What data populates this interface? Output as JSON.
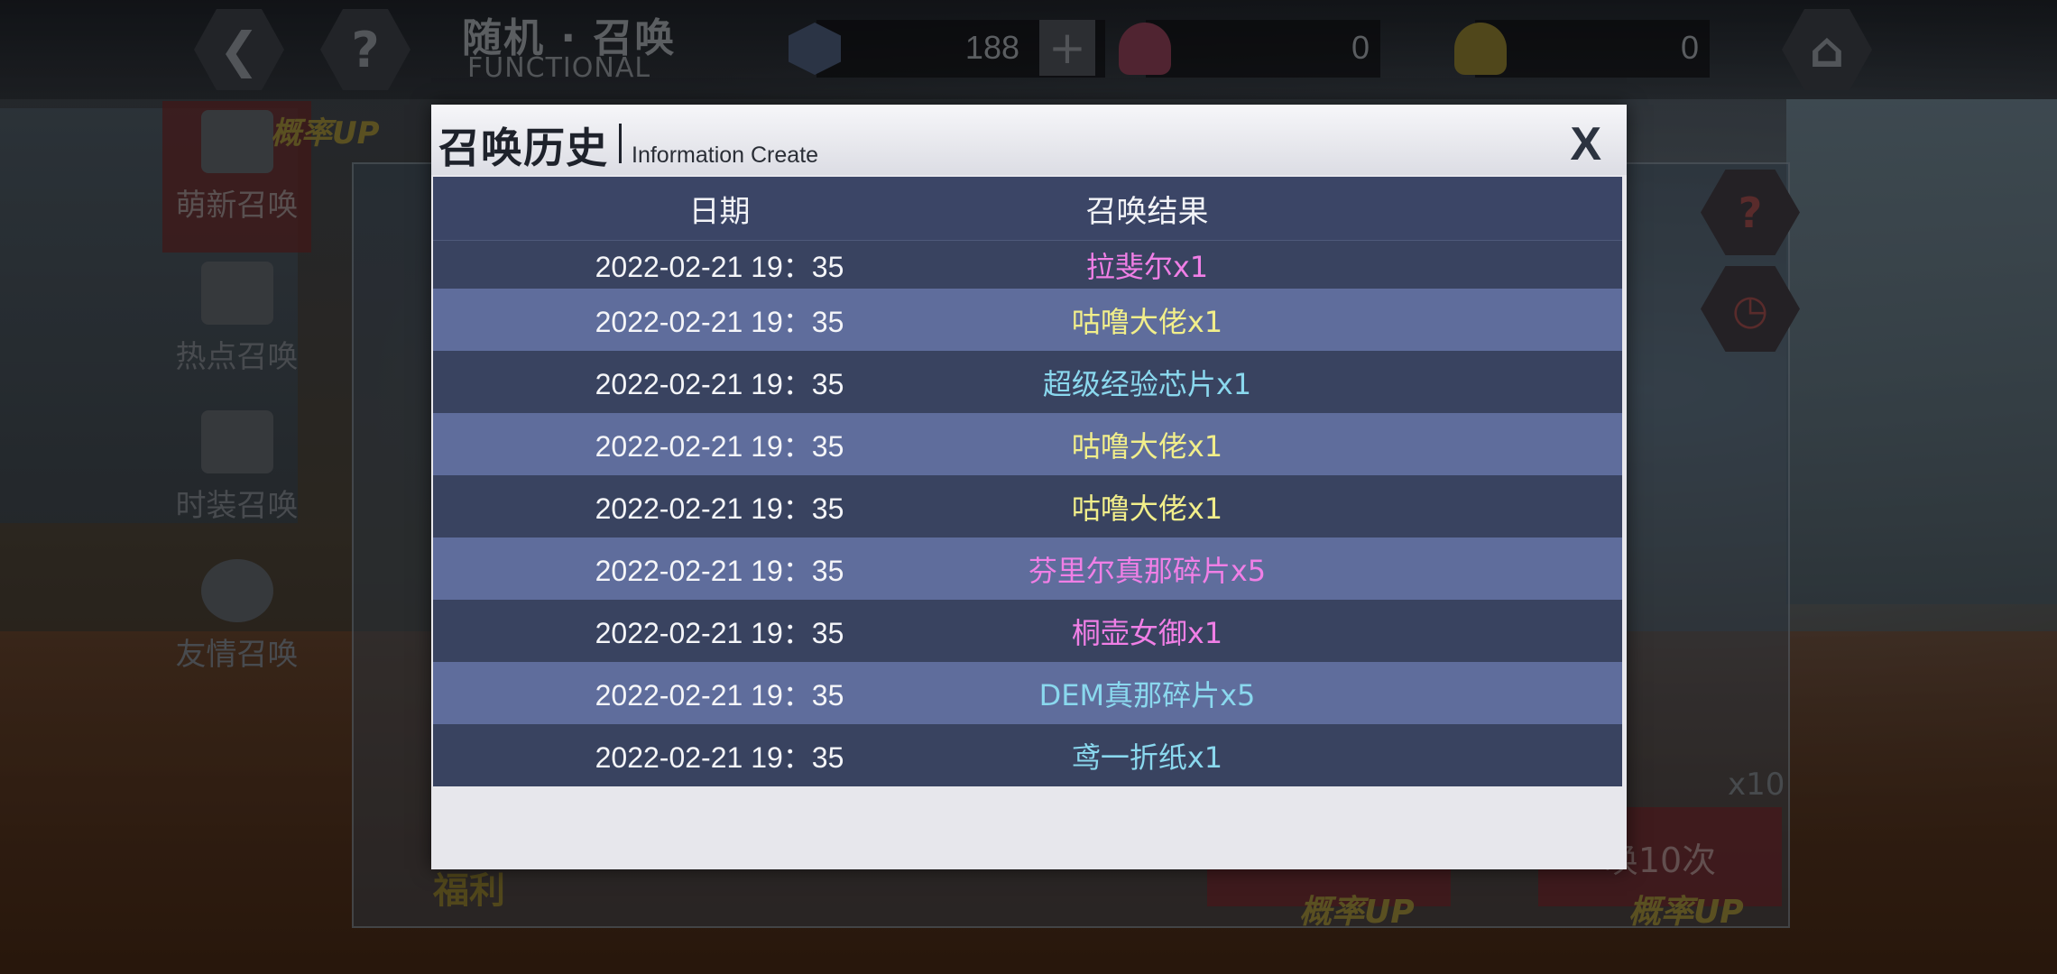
{
  "topbar": {
    "title_cn": "随机 · 召唤",
    "title_en": "FUNCTIONAL",
    "back_icon": "back-arrow-icon",
    "help_icon": "question-icon",
    "home_icon": "home-icon",
    "gem_value": "188",
    "heart_red_value": "0",
    "heart_gold_value": "0"
  },
  "sidebar": {
    "rate_up": "概率UP",
    "items": [
      {
        "label": "萌新召唤",
        "active": true
      },
      {
        "label": "热点召唤",
        "active": false
      },
      {
        "label": "时装召唤",
        "active": false
      },
      {
        "label": "友情召唤",
        "active": false
      }
    ]
  },
  "background": {
    "x10_label": "x10",
    "summon10_label": "唤10次",
    "rate_up_1": "概率UP",
    "rate_up_2": "概率UP",
    "fuli": "福利"
  },
  "modal": {
    "title": "召唤历史",
    "subtitle": "Information Create",
    "close": "X",
    "columns": {
      "date": "日期",
      "result": "召唤结果"
    },
    "rows": [
      {
        "date": "2022-02-21 19：35",
        "result": "拉斐尔x1",
        "color": "#f07fe6"
      },
      {
        "date": "2022-02-21 19：35",
        "result": "咕噜大佬x1",
        "color": "#f1ee8a"
      },
      {
        "date": "2022-02-21 19：35",
        "result": "超级经验芯片x1",
        "color": "#8ad8ee"
      },
      {
        "date": "2022-02-21 19：35",
        "result": "咕噜大佬x1",
        "color": "#f1ee8a"
      },
      {
        "date": "2022-02-21 19：35",
        "result": "咕噜大佬x1",
        "color": "#f1ee8a"
      },
      {
        "date": "2022-02-21 19：35",
        "result": "芬里尔真那碎片x5",
        "color": "#f07fe6"
      },
      {
        "date": "2022-02-21 19：35",
        "result": "桐壶女御x1",
        "color": "#f07fe6"
      },
      {
        "date": "2022-02-21 19：35",
        "result": "DEM真那碎片x5",
        "color": "#8ad8ee"
      },
      {
        "date": "2022-02-21 19：35",
        "result": "鸢一折纸x1",
        "color": "#8ad8ee"
      }
    ]
  }
}
